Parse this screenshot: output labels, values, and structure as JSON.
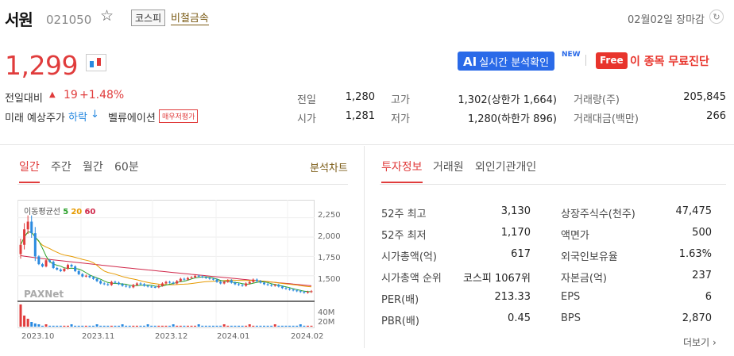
{
  "header": {
    "name": "서원",
    "code": "021050",
    "star_icon": "star-outline-icon",
    "market": "코스피",
    "sector": "비철금속",
    "date": "02월02일 장마감",
    "refresh_icon": "refresh-icon"
  },
  "price": {
    "current": "1,299",
    "change_label": "전일대비",
    "change_arrow": "▲",
    "change_value": "19",
    "change_percent": "+1.48%",
    "forecast_label": "미래 예상주가",
    "forecast_value": "하락",
    "forecast_arrow": "↓",
    "valuation_label": "벨류에이션",
    "valuation_tag": "매우저평가"
  },
  "promo": {
    "ai_prefix": "AI",
    "ai_label": "실시간 분석확인",
    "new_tag": "NEW",
    "free_tag": "Free",
    "diag_label": "이 종목 무료진단"
  },
  "quote": {
    "prev_label": "전일",
    "prev_value": "1,280",
    "open_label": "시가",
    "open_value": "1,281",
    "high_label": "고가",
    "high_value": "1,302(상한가 1,664)",
    "low_label": "저가",
    "low_value": "1,280(하한가 896)",
    "volume_label": "거래량(주)",
    "volume_value": "205,845",
    "amount_label": "거래대금(백만)",
    "amount_value": "266"
  },
  "chart_tabs": [
    "일간",
    "주간",
    "월간",
    "60분"
  ],
  "chart_analysis_link": "분석차트",
  "info_tabs": [
    "투자정보",
    "거래원",
    "외인기관개인"
  ],
  "chart_data": {
    "type": "candlestick",
    "ma_legend": {
      "title": "이동평균선",
      "ma5": "5",
      "ma20": "20",
      "ma60": "60"
    },
    "watermark": "PAXNet",
    "price_ticks": [
      "2,250",
      "2,000",
      "1,750",
      "1,500"
    ],
    "volume_ticks": [
      "40M",
      "20M"
    ],
    "x_ticks": [
      "2023.10",
      "2023.11",
      "2023.12",
      "2024.01",
      "2024.02"
    ],
    "ylim": [
      1200,
      2400
    ],
    "close": [
      1900,
      2100,
      2200,
      2050,
      1750,
      1650,
      1620,
      1700,
      1680,
      1600,
      1580,
      1560,
      1590,
      1640,
      1620,
      1560,
      1520,
      1490,
      1500,
      1480,
      1460,
      1430,
      1400,
      1390,
      1380,
      1420,
      1410,
      1390,
      1370,
      1360,
      1350,
      1380,
      1400,
      1390,
      1370,
      1360,
      1355,
      1350,
      1370,
      1400,
      1420,
      1410,
      1400,
      1430,
      1460,
      1450,
      1470,
      1480,
      1500,
      1490,
      1480,
      1470,
      1460,
      1450,
      1420,
      1400,
      1420,
      1440,
      1410,
      1390,
      1380,
      1370,
      1400,
      1420,
      1450,
      1430,
      1410,
      1390,
      1380,
      1370,
      1380,
      1360,
      1340,
      1330,
      1320,
      1310,
      1300,
      1290,
      1280,
      1290,
      1299
    ]
  },
  "invest_info": [
    {
      "label": "52주 최고",
      "value": "3,130",
      "label2": "상장주식수(천주)",
      "value2": "47,475"
    },
    {
      "label": "52주 최저",
      "value": "1,170",
      "label2": "액면가",
      "value2": "500"
    },
    {
      "label": "시가총액(억)",
      "value": "617",
      "label2": "외국인보유율",
      "value2": "1.63%"
    },
    {
      "label": "시가총액 순위",
      "value": "코스피 1067위",
      "label2": "자본금(억)",
      "value2": "237"
    },
    {
      "label": "PER(배)",
      "value": "213.33",
      "label2": "EPS",
      "value2": "6"
    },
    {
      "label": "PBR(배)",
      "value": "0.45",
      "label2": "BPS",
      "value2": "2,870"
    }
  ],
  "more_link": "더보기",
  "colors": {
    "up": "#e03c3c",
    "down": "#2a8ae0",
    "ai": "#2a6ae8",
    "free": "#e8342c"
  }
}
